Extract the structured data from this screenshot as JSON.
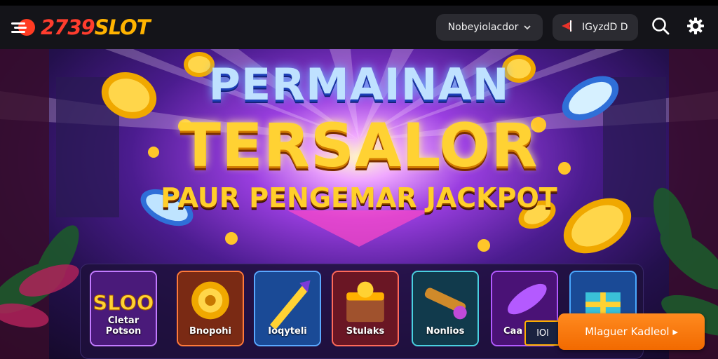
{
  "header": {
    "logo_text_a": "2739",
    "logo_text_b": "SLOT",
    "language_label": "Nobeyiolacdor",
    "currency_label": "IGyzdD D",
    "icons": [
      "logo-icon",
      "chevron-down-icon",
      "flag-icon",
      "search-icon",
      "settings-icon"
    ]
  },
  "banner": {
    "line1": "PERMAINAN",
    "line2": "TERSALOR",
    "line3": "PAUR PENGEMAR JACKPOT"
  },
  "games": [
    {
      "label": "Cletar Potson",
      "art_text": "SLOO",
      "color": "#6b2aa8"
    },
    {
      "label": "Bnopohi",
      "color": "#8a2a1a"
    },
    {
      "label": "Ioqyteli",
      "color": "#1a56a8"
    },
    {
      "label": "Stulaks",
      "color": "#7a1f2a"
    },
    {
      "label": "Nonlios",
      "color": "#17485c"
    },
    {
      "label": "Caa",
      "color": "#5a1f8a"
    },
    {
      "label": "",
      "color": "#1b5aa8"
    }
  ],
  "mini_badge": "lOl",
  "cta_label": "Mlaguer Kadleol ▸",
  "colors": {
    "accent_orange": "#f26a00",
    "gold": "#ffd233",
    "header_bg": "#141419"
  }
}
